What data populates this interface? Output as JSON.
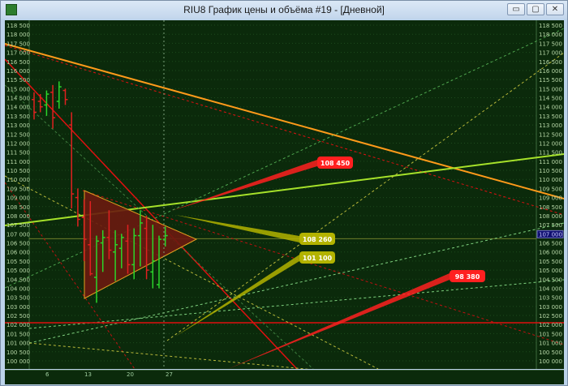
{
  "window": {
    "title": "RIU8 График цены и объёма #19 - [Дневной]",
    "buttons": {
      "minimize": "▭",
      "maximize": "▢",
      "close": "✕"
    }
  },
  "colors": {
    "background": "#0b2a0b",
    "bull_candle": "#2bd52b",
    "bear_candle": "#e02020",
    "axis_text": "#b8d8a8",
    "label_red": "#ff2020",
    "label_olive": "#b3b300"
  },
  "chart_data": {
    "type": "candlestick",
    "y_ticks": [
      "118 500",
      "118 000",
      "117 500",
      "117 000",
      "116 500",
      "116 000",
      "115 500",
      "115 000",
      "114 500",
      "114 000",
      "113 500",
      "113 000",
      "112 500",
      "112 000",
      "111 500",
      "111 000",
      "110 500",
      "110 000",
      "109 500",
      "109 000",
      "108 500",
      "108 000",
      "107 500",
      "107 000",
      "106 500",
      "106 000",
      "105 500",
      "105 000",
      "104 500",
      "104 000",
      "103 500",
      "103 000",
      "102 500",
      "102 000",
      "101 500",
      "101 000",
      "100 500",
      "100 000"
    ],
    "ylim": [
      100000,
      118500
    ],
    "x_ticks": [
      "6",
      "13",
      "20",
      "27"
    ],
    "current_price_label": "107 000",
    "annotations": [
      {
        "text": "108 450",
        "color": "red"
      },
      {
        "text": "108 260",
        "color": "olive"
      },
      {
        "text": "101 100",
        "color": "olive"
      },
      {
        "text": "98 380",
        "color": "red"
      }
    ],
    "candles": [
      {
        "o": 114400,
        "h": 114800,
        "l": 113300,
        "c": 113700
      },
      {
        "o": 114300,
        "h": 114700,
        "l": 113700,
        "c": 114000
      },
      {
        "o": 114100,
        "h": 114900,
        "l": 113500,
        "c": 114700
      },
      {
        "o": 114800,
        "h": 115200,
        "l": 112800,
        "c": 113400
      },
      {
        "o": 114300,
        "h": 115400,
        "l": 113900,
        "c": 115100
      },
      {
        "o": 114900,
        "h": 115000,
        "l": 114100,
        "c": 114400
      },
      {
        "o": 113000,
        "h": 113700,
        "l": 108400,
        "c": 109200
      },
      {
        "o": 109000,
        "h": 109500,
        "l": 107400,
        "c": 107800
      },
      {
        "o": 107900,
        "h": 108900,
        "l": 105500,
        "c": 106700
      },
      {
        "o": 106400,
        "h": 108800,
        "l": 104700,
        "c": 104800
      },
      {
        "o": 104600,
        "h": 106900,
        "l": 103200,
        "c": 106600
      },
      {
        "o": 106500,
        "h": 107200,
        "l": 104900,
        "c": 106800
      },
      {
        "o": 106800,
        "h": 108300,
        "l": 105600,
        "c": 106100
      },
      {
        "o": 106000,
        "h": 107200,
        "l": 104400,
        "c": 106400
      },
      {
        "o": 106200,
        "h": 107000,
        "l": 105100,
        "c": 106800
      },
      {
        "o": 106600,
        "h": 107500,
        "l": 104800,
        "c": 105300
      },
      {
        "o": 105300,
        "h": 107300,
        "l": 104500,
        "c": 106900
      },
      {
        "o": 106900,
        "h": 108300,
        "l": 105200,
        "c": 107600
      },
      {
        "o": 107300,
        "h": 108000,
        "l": 104500,
        "c": 105000
      },
      {
        "o": 104900,
        "h": 107500,
        "l": 104000,
        "c": 105500
      },
      {
        "o": 104200,
        "h": 106900,
        "l": 104000,
        "c": 106700
      },
      {
        "o": 106700,
        "h": 107400,
        "l": 106300,
        "c": 106900
      }
    ]
  }
}
